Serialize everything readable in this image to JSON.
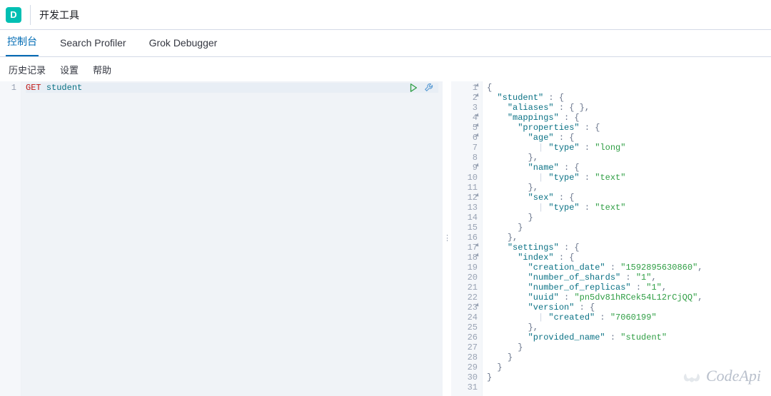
{
  "header": {
    "badge": "D",
    "breadcrumb": "开发工具"
  },
  "tabs": [
    {
      "label": "控制台",
      "active": true
    },
    {
      "label": "Search Profiler",
      "active": false
    },
    {
      "label": "Grok Debugger",
      "active": false
    }
  ],
  "subnav": {
    "history": "历史记录",
    "settings": "设置",
    "help": "帮助"
  },
  "editor": {
    "lines": [
      {
        "n": 1,
        "tokens": [
          [
            "method",
            "GET"
          ],
          [
            "space",
            " "
          ],
          [
            "ident",
            "student"
          ]
        ]
      }
    ],
    "actions": {
      "run": "run-icon",
      "wrench": "wrench-icon"
    }
  },
  "response": {
    "lines": [
      {
        "n": 1,
        "fold": true,
        "indent": 0,
        "tokens": [
          [
            "punc",
            "{"
          ]
        ]
      },
      {
        "n": 2,
        "fold": true,
        "indent": 1,
        "tokens": [
          [
            "key",
            "\"student\""
          ],
          [
            "punc",
            " : {"
          ]
        ]
      },
      {
        "n": 3,
        "indent": 2,
        "tokens": [
          [
            "key",
            "\"aliases\""
          ],
          [
            "punc",
            " : { },"
          ]
        ]
      },
      {
        "n": 4,
        "fold": true,
        "indent": 2,
        "tokens": [
          [
            "key",
            "\"mappings\""
          ],
          [
            "punc",
            " : {"
          ]
        ]
      },
      {
        "n": 5,
        "fold": true,
        "indent": 3,
        "tokens": [
          [
            "key",
            "\"properties\""
          ],
          [
            "punc",
            " : {"
          ]
        ]
      },
      {
        "n": 6,
        "fold": true,
        "indent": 4,
        "tokens": [
          [
            "key",
            "\"age\""
          ],
          [
            "punc",
            " : {"
          ]
        ]
      },
      {
        "n": 7,
        "indent": 5,
        "guide": true,
        "tokens": [
          [
            "key",
            "\"type\""
          ],
          [
            "punc",
            " : "
          ],
          [
            "str",
            "\"long\""
          ]
        ]
      },
      {
        "n": 8,
        "indent": 4,
        "tokens": [
          [
            "punc",
            "},"
          ]
        ]
      },
      {
        "n": 9,
        "fold": true,
        "indent": 4,
        "tokens": [
          [
            "key",
            "\"name\""
          ],
          [
            "punc",
            " : {"
          ]
        ]
      },
      {
        "n": 10,
        "indent": 5,
        "guide": true,
        "tokens": [
          [
            "key",
            "\"type\""
          ],
          [
            "punc",
            " : "
          ],
          [
            "str",
            "\"text\""
          ]
        ]
      },
      {
        "n": 11,
        "indent": 4,
        "tokens": [
          [
            "punc",
            "},"
          ]
        ]
      },
      {
        "n": 12,
        "fold": true,
        "indent": 4,
        "tokens": [
          [
            "key",
            "\"sex\""
          ],
          [
            "punc",
            " : {"
          ]
        ]
      },
      {
        "n": 13,
        "indent": 5,
        "guide": true,
        "tokens": [
          [
            "key",
            "\"type\""
          ],
          [
            "punc",
            " : "
          ],
          [
            "str",
            "\"text\""
          ]
        ]
      },
      {
        "n": 14,
        "indent": 4,
        "tokens": [
          [
            "punc",
            "}"
          ]
        ]
      },
      {
        "n": 15,
        "indent": 3,
        "tokens": [
          [
            "punc",
            "}"
          ]
        ]
      },
      {
        "n": 16,
        "indent": 2,
        "tokens": [
          [
            "punc",
            "},"
          ]
        ]
      },
      {
        "n": 17,
        "fold": true,
        "indent": 2,
        "tokens": [
          [
            "key",
            "\"settings\""
          ],
          [
            "punc",
            " : {"
          ]
        ]
      },
      {
        "n": 18,
        "fold": true,
        "indent": 3,
        "tokens": [
          [
            "key",
            "\"index\""
          ],
          [
            "punc",
            " : {"
          ]
        ]
      },
      {
        "n": 19,
        "indent": 4,
        "tokens": [
          [
            "key",
            "\"creation_date\""
          ],
          [
            "punc",
            " : "
          ],
          [
            "str",
            "\"1592895630860\""
          ],
          [
            "punc",
            ","
          ]
        ]
      },
      {
        "n": 20,
        "indent": 4,
        "tokens": [
          [
            "key",
            "\"number_of_shards\""
          ],
          [
            "punc",
            " : "
          ],
          [
            "str",
            "\"1\""
          ],
          [
            "punc",
            ","
          ]
        ]
      },
      {
        "n": 21,
        "indent": 4,
        "tokens": [
          [
            "key",
            "\"number_of_replicas\""
          ],
          [
            "punc",
            " : "
          ],
          [
            "str",
            "\"1\""
          ],
          [
            "punc",
            ","
          ]
        ]
      },
      {
        "n": 22,
        "indent": 4,
        "tokens": [
          [
            "key",
            "\"uuid\""
          ],
          [
            "punc",
            " : "
          ],
          [
            "str",
            "\"pn5dv81hRCek54L12rCjQQ\""
          ],
          [
            "punc",
            ","
          ]
        ]
      },
      {
        "n": 23,
        "fold": true,
        "indent": 4,
        "tokens": [
          [
            "key",
            "\"version\""
          ],
          [
            "punc",
            " : {"
          ]
        ]
      },
      {
        "n": 24,
        "indent": 5,
        "guide": true,
        "tokens": [
          [
            "key",
            "\"created\""
          ],
          [
            "punc",
            " : "
          ],
          [
            "str",
            "\"7060199\""
          ]
        ]
      },
      {
        "n": 25,
        "indent": 4,
        "tokens": [
          [
            "punc",
            "},"
          ]
        ]
      },
      {
        "n": 26,
        "indent": 4,
        "tokens": [
          [
            "key",
            "\"provided_name\""
          ],
          [
            "punc",
            " : "
          ],
          [
            "str",
            "\"student\""
          ]
        ]
      },
      {
        "n": 27,
        "indent": 3,
        "tokens": [
          [
            "punc",
            "}"
          ]
        ]
      },
      {
        "n": 28,
        "indent": 2,
        "tokens": [
          [
            "punc",
            "}"
          ]
        ]
      },
      {
        "n": 29,
        "indent": 1,
        "tokens": [
          [
            "punc",
            "}"
          ]
        ]
      },
      {
        "n": 30,
        "indent": 0,
        "tokens": [
          [
            "punc",
            "}"
          ]
        ]
      },
      {
        "n": 31,
        "indent": 0,
        "tokens": []
      }
    ]
  },
  "watermark": "CodeApi"
}
